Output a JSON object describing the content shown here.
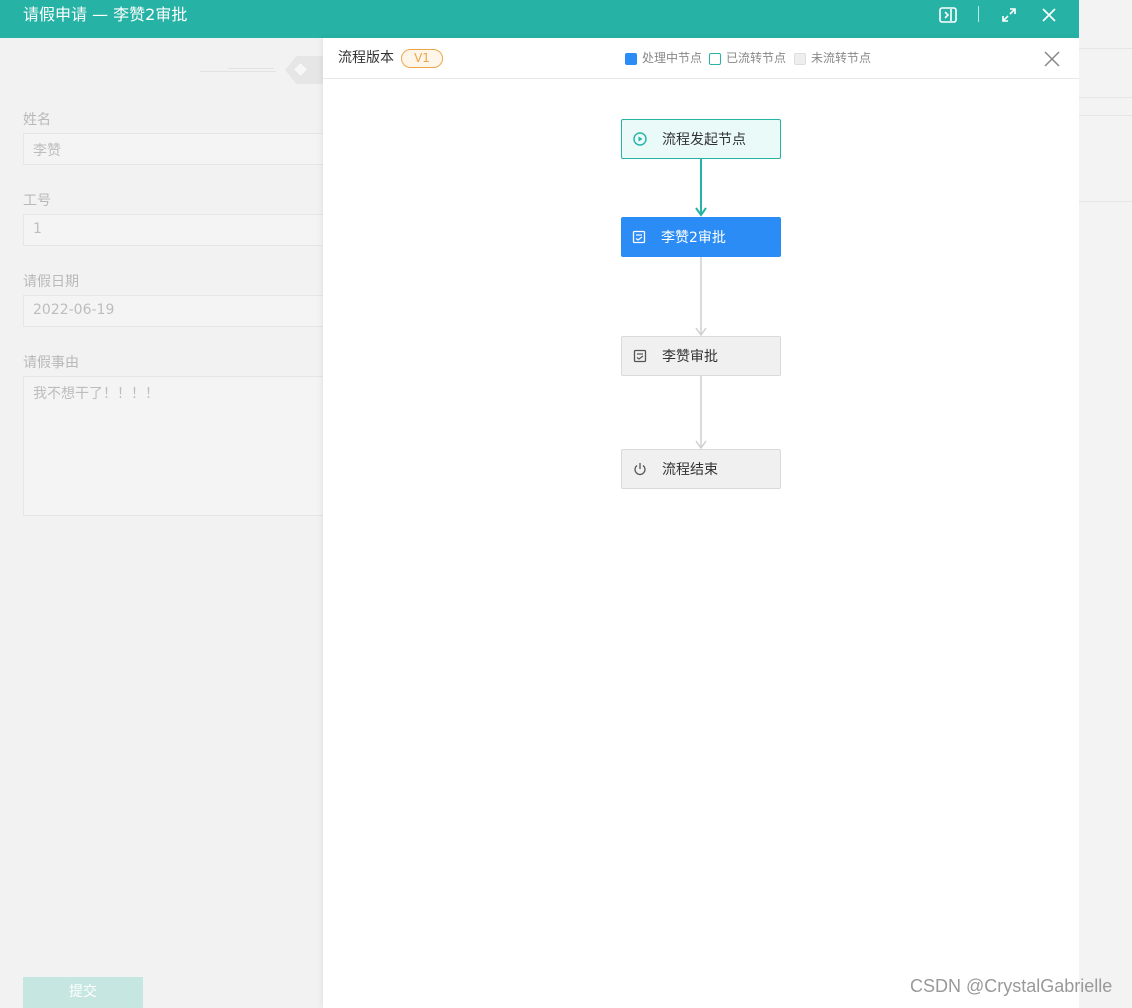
{
  "window": {
    "title": "请假申请 — 李赞2审批"
  },
  "form": {
    "fields": [
      {
        "label": "姓名",
        "value": "李赞"
      },
      {
        "label": "工号",
        "value": "1"
      },
      {
        "label": "请假日期",
        "value": "2022-06-19"
      },
      {
        "label": "请假事由",
        "value": "我不想干了！！！！"
      }
    ],
    "submit_label": "提交"
  },
  "flow_panel": {
    "version_label": "流程版本",
    "version": "V1",
    "legend": [
      {
        "label": "处理中节点",
        "color": "#2b8cf5"
      },
      {
        "label": "已流转节点",
        "color": "#26b2a5"
      },
      {
        "label": "未流转节点",
        "color": "#d9d9d9"
      }
    ],
    "nodes": [
      {
        "label": "流程发起节点",
        "status": "done",
        "icon": "play-circle-icon"
      },
      {
        "label": "李赞2审批",
        "status": "active",
        "icon": "approval-icon"
      },
      {
        "label": "李赞审批",
        "status": "pending",
        "icon": "approval-icon"
      },
      {
        "label": "流程结束",
        "status": "pending",
        "icon": "power-icon"
      }
    ]
  },
  "colors": {
    "accent": "#26b2a5",
    "active": "#2b8cf5",
    "badge": "#f0a44a"
  },
  "watermark": "CSDN @CrystalGabrielle"
}
